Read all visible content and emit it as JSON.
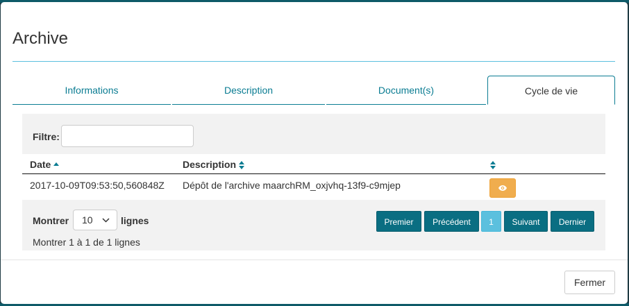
{
  "modal": {
    "title": "Archive"
  },
  "tabs": [
    {
      "label": "Informations",
      "active": false
    },
    {
      "label": "Description",
      "active": false
    },
    {
      "label": "Document(s)",
      "active": false
    },
    {
      "label": "Cycle de vie",
      "active": true
    }
  ],
  "filter": {
    "label": "Filtre:",
    "value": ""
  },
  "table": {
    "columns": [
      {
        "label": "Date",
        "sort": "asc"
      },
      {
        "label": "Description",
        "sort": "both"
      },
      {
        "label": "",
        "sort": "both"
      }
    ],
    "rows": [
      {
        "date": "2017-10-09T09:53:50,560848Z",
        "description": "Dépôt de l'archive maarchRM_oxjvhq-13f9-c9mjep",
        "action_icon": "eye-icon"
      }
    ]
  },
  "length_menu": {
    "prefix": "Montrer",
    "selected": "10",
    "suffix": "lignes"
  },
  "info": "Montrer 1 à 1 de 1 lignes",
  "pagination": {
    "first": "Premier",
    "previous": "Précédent",
    "current_page": "1",
    "next": "Suivant",
    "last": "Dernier"
  },
  "footer": {
    "close_label": "Fermer"
  },
  "colors": {
    "accent": "#0a7c92",
    "button_dark": "#0a6e82",
    "button_active": "#5bc0de",
    "warning": "#f0ad4e",
    "panel": "#f2f2f2"
  }
}
